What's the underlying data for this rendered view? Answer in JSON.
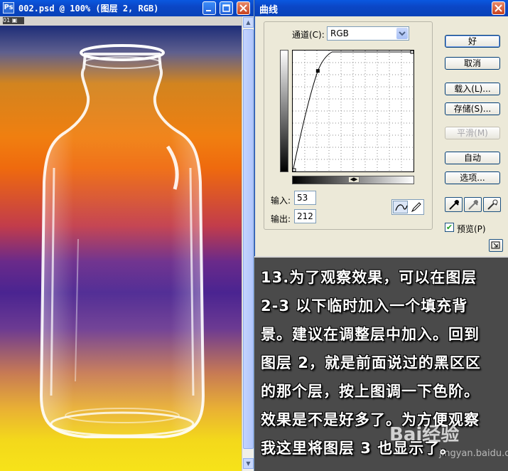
{
  "document": {
    "title": "002.psd @ 100% (图层 2, RGB)",
    "subbar_label": "01"
  },
  "curves": {
    "title": "曲线",
    "channel_label": "通道(C):",
    "channel_value": "RGB",
    "input_label": "输入:",
    "input_value": "53",
    "output_label": "输出:",
    "output_value": "212",
    "buttons": {
      "ok": "好",
      "cancel": "取消",
      "load": "载入(L)...",
      "save": "存储(S)...",
      "smooth": "平滑(M)",
      "auto": "自动",
      "options": "选项..."
    },
    "preview_label": "预览(P)",
    "preview_checked": true,
    "curve_point": {
      "input": 53,
      "output": 212
    }
  },
  "caption": {
    "lines": [
      "13.为了观察效果，可以在图层",
      "2-3 以下临时加入一个填充背",
      "景。建议在调整层中加入。回到",
      "图层 2，就是前面说过的黑区区",
      "的那个层，按上图调一下色阶。",
      "效果是不是好多了。为方便观察",
      "我这里将图层 3 也显示了。"
    ]
  },
  "watermark": {
    "brand": "Bai",
    "brand2": "经验",
    "url": "jingyan.baidu.com"
  },
  "colors": {
    "titlebar": "#0b47c6",
    "dialog_bg": "#ece9d8",
    "caption_bg": "#4a4a4a"
  }
}
